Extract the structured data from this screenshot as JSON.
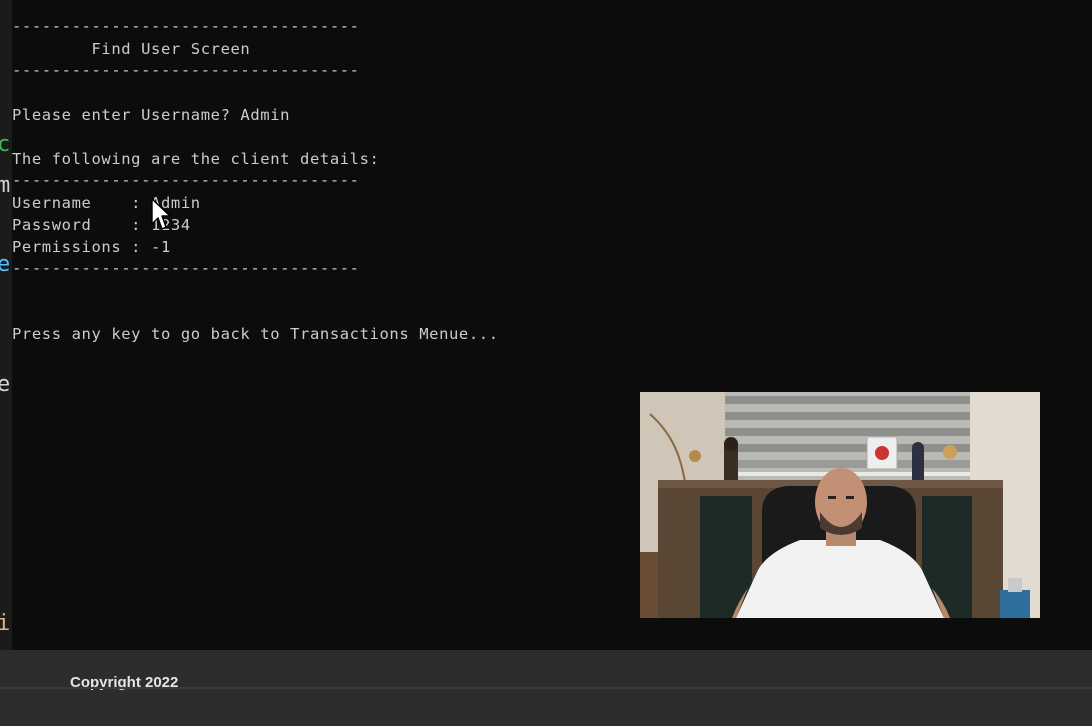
{
  "console": {
    "divider": "-----------------------------------",
    "header_title": "        Find User Screen",
    "prompt": "Please enter Username? Admin",
    "details_heading": "The following are the client details:",
    "fields": [
      {
        "text": "Username    : Admin"
      },
      {
        "text": "Password    : 1234"
      },
      {
        "text": "Permissions : -1"
      }
    ],
    "footer_prompt": "Press any key to go back to Transactions Menue..."
  },
  "editor_edge": {
    "glyphs": [
      "c",
      "m",
      "e",
      "e",
      "i"
    ],
    "colors": [
      "#3fb950",
      "#d4d4d4",
      "#4fc1ff",
      "#d4d4d4",
      "#d7ba7d"
    ]
  },
  "webcam": {
    "icon": "presenter-video-feed"
  },
  "footer": {
    "copyright": "Copyright 2022"
  },
  "colors": {
    "console_bg": "#0c0c0c",
    "console_text": "#cccccc",
    "footer_bg": "#2d2d2d",
    "footer_text": "#e6e6e6"
  }
}
